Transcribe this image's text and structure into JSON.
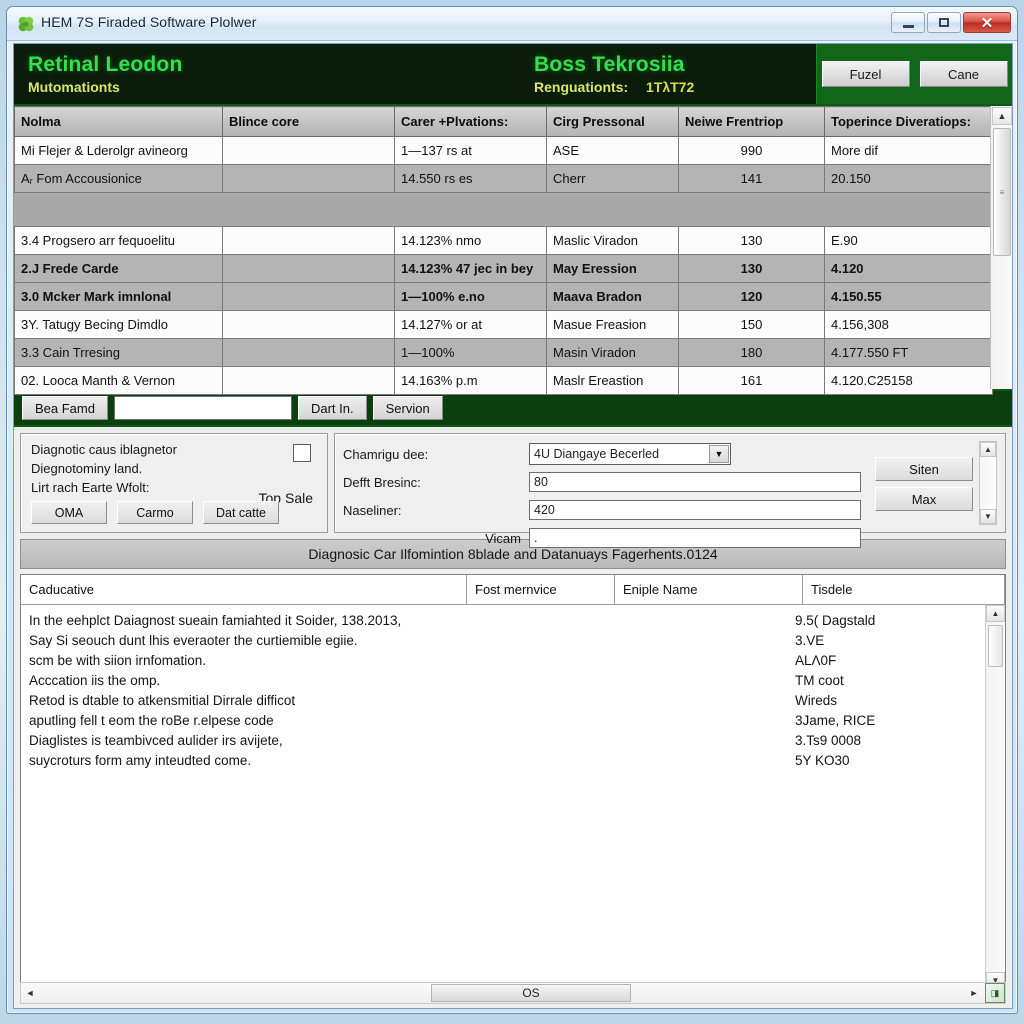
{
  "window": {
    "title": "HEM 7S Firaded Software Plolwer",
    "icon": "clover-icon",
    "minimize_label": "minimize",
    "maximize_label": "maximize",
    "close_label": "✕"
  },
  "banner": {
    "left_title": "Retinal Leodon",
    "left_subtitle": "Mutomationts",
    "center_title": "Boss Tekrosiia",
    "center_sub_label": "Renguationts:",
    "center_sub_value": "1TλT72",
    "buttons": [
      {
        "label": "Fuzel",
        "name": "fuzel-button"
      },
      {
        "label": "Cane",
        "name": "cane-button"
      }
    ]
  },
  "grid": {
    "columns": [
      "Nolma",
      "Blince core",
      "Carer +Plvations:",
      "Cirg Pressonal",
      "Neiwe Frentriop",
      "Toperince Diveratiops:"
    ],
    "rows": [
      {
        "style": "light",
        "bold": false,
        "cells": [
          "Mi Flejer & Lderolgr avineorg",
          "",
          "1—137 rs at",
          "ASE",
          "990",
          "More dif"
        ]
      },
      {
        "style": "dark",
        "bold": false,
        "cells": [
          "Aᵣ Fom Accousionice",
          "",
          "14.550 rs es",
          "Cherr",
          "141",
          "20.150"
        ]
      },
      {
        "style": "gap",
        "bold": false,
        "cells": [
          "",
          "",
          "",
          "",
          "",
          ""
        ]
      },
      {
        "style": "light",
        "bold": false,
        "cells": [
          "3.4 Progsero arr fequoelitu",
          "",
          "14.123% nmo",
          "Maslic Viradon",
          "130",
          "E.90"
        ]
      },
      {
        "style": "dark",
        "bold": true,
        "cells": [
          "2.J Frede Carde",
          "",
          "14.123% 47 jec in bey",
          "May Eression",
          "130",
          "4.120"
        ]
      },
      {
        "style": "dark",
        "bold": true,
        "cells": [
          "3.0 Mcker Mark imnlonal",
          "",
          "1—100% e.no",
          "Maava Bradon",
          "120",
          "4.150.55"
        ]
      },
      {
        "style": "light",
        "bold": false,
        "cells": [
          "3Y. Tatugy Becing Dimdlo",
          "",
          "14.127% or at",
          "Masue Freasion",
          "150",
          "4.156,308"
        ]
      },
      {
        "style": "dark",
        "bold": false,
        "cells": [
          "3.3 Cain Trresing",
          "",
          "1—100%",
          "Masin Viradon",
          "180",
          "4.177.550 FT"
        ]
      },
      {
        "style": "light",
        "bold": false,
        "cells": [
          "02. Looca Manth & Vernon",
          "",
          "14.163% p.m",
          "Maslr Ereastion",
          "161",
          "4.120.C25158"
        ]
      }
    ],
    "scroll_up_icon": "▲",
    "scroll_down_icon": "▼"
  },
  "toolbar": {
    "find_label": "Bea Famd",
    "search_value": "",
    "search_placeholder": "",
    "buttons": [
      {
        "label": "Dart In.",
        "name": "dart-in-button"
      },
      {
        "label": "Servion",
        "name": "servion-button"
      }
    ]
  },
  "left_panel": {
    "line1": "Diagnotic caus iblagnetor",
    "line2": "Diegnotominy land.",
    "line3": "Lirt rach Earte Wfolt:",
    "top_sale": "Top Sale",
    "checkbox_checked": false,
    "buttons": [
      {
        "label": "OMA",
        "name": "oma-button"
      },
      {
        "label": "Carmo",
        "name": "carmo-button"
      },
      {
        "label": "Dat catte",
        "name": "dat-catte-button"
      }
    ]
  },
  "right_panel": {
    "fields": [
      {
        "label": "Chamrigu dee:",
        "type": "combo",
        "value": "4U Diangaye Becerled"
      },
      {
        "label": "Defft Bresinc:",
        "type": "text",
        "value": "80"
      },
      {
        "label": "Naseliner:",
        "type": "text",
        "value": "420"
      },
      {
        "label": "Vicam",
        "type": "text",
        "value": "."
      }
    ],
    "buttons": [
      {
        "label": "Siten",
        "name": "siten-button"
      },
      {
        "label": "Max",
        "name": "max-button"
      }
    ],
    "scroll_up_icon": "▲",
    "scroll_down_icon": "▼",
    "combo_arrow": "▼"
  },
  "section_title": "Diagnosic Car Ilfomintion 8blade and Datanuays Fagerhents.0124",
  "bottom": {
    "columns": [
      "Caducative",
      "Fost mernvice",
      "Eniple Name",
      "Tisdele"
    ],
    "left_lines": [
      "In the eehplct Daiagnost sueain famiahted it Soider, 138.2013,",
      "Say Si seouch dunt lhis everaoter the curtiemible egiie.",
      "scm be with siion irnfomation.",
      "Acccation iis the omp.",
      "Retod is dtable to atkensmitial Dirrale difficot",
      "aputling fell t eom the roBe r.elpese code",
      "Diaglistes is teambivced aulider irs avijete,",
      "suycroturs form amy inteudted come."
    ],
    "right_lines": [
      "9.5( Dagstald",
      "3.VE",
      "ALΛ0F",
      "TM coot",
      "Wireds",
      "3Jame, RICE",
      "3.Ts9 0008",
      "5Y KO30"
    ],
    "scroll_up_icon": "▲",
    "scroll_down_icon": "▼"
  },
  "hscroll": {
    "left_arrow": "◄",
    "right_arrow": "►",
    "thumb_label": "OS",
    "grip_label": "◨"
  }
}
